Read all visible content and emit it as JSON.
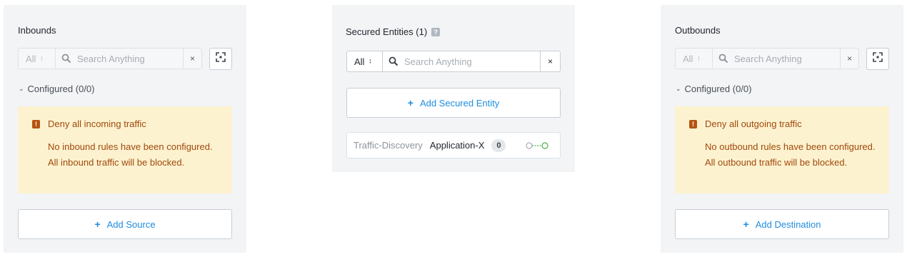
{
  "inbound": {
    "title": "Inbounds",
    "search": {
      "scope": "All",
      "placeholder": "Search Anything",
      "clear": "×"
    },
    "configured_label": "Configured (0/0)",
    "alert": {
      "title": "Deny all incoming traffic",
      "body": "No inbound rules have been configured. All inbound traffic will be blocked."
    },
    "add_label": "Add Source"
  },
  "secured": {
    "title": "Secured Entities (1)",
    "help": "?",
    "search": {
      "scope": "All",
      "placeholder": "Search Anything",
      "clear": "×"
    },
    "add_label": "Add Secured Entity",
    "entities": [
      {
        "type": "Traffic-Discovery",
        "name": "Application-X",
        "count": "0"
      }
    ]
  },
  "outbound": {
    "title": "Outbounds",
    "search": {
      "scope": "All",
      "placeholder": "Search Anything",
      "clear": "×"
    },
    "configured_label": "Configured (0/0)",
    "alert": {
      "title": "Deny all outgoing traffic",
      "body": "No outbound rules have been configured. All outbound traffic will be blocked."
    },
    "add_label": "Add Destination"
  },
  "colors": {
    "panel_bg": "#f2f4f6",
    "warning_bg": "#fdf2cf",
    "warning_text": "#a0490c",
    "accent": "#1e8de0"
  }
}
